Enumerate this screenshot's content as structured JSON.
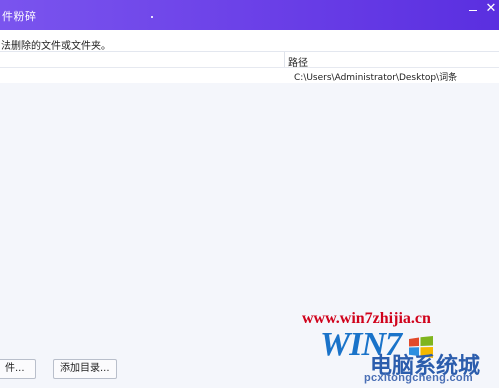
{
  "window": {
    "title": "件粉碎",
    "close_glyph": "✕"
  },
  "hint_text": "法删除的文件或文件夹。",
  "table": {
    "columns": [
      "",
      "路径"
    ],
    "rows": [
      {
        "path": "C:\\Users\\Administrator\\Desktop\\词条"
      }
    ]
  },
  "footer": {
    "add_file_label": "件...",
    "add_dir_label": "添加目录..."
  },
  "watermark": {
    "url": "www.win7zhijia.cn",
    "brand": "WIN7",
    "brand_cn": "电脑系统城",
    "pinyin": "pcxitongcheng.com",
    "icon": "windows-flag-icon"
  },
  "colors": {
    "titlebar": "#6a3fe7",
    "list_bg": "#f4f6fb",
    "watermark_red": "#d0021b",
    "watermark_blue": "#1a73c9"
  }
}
